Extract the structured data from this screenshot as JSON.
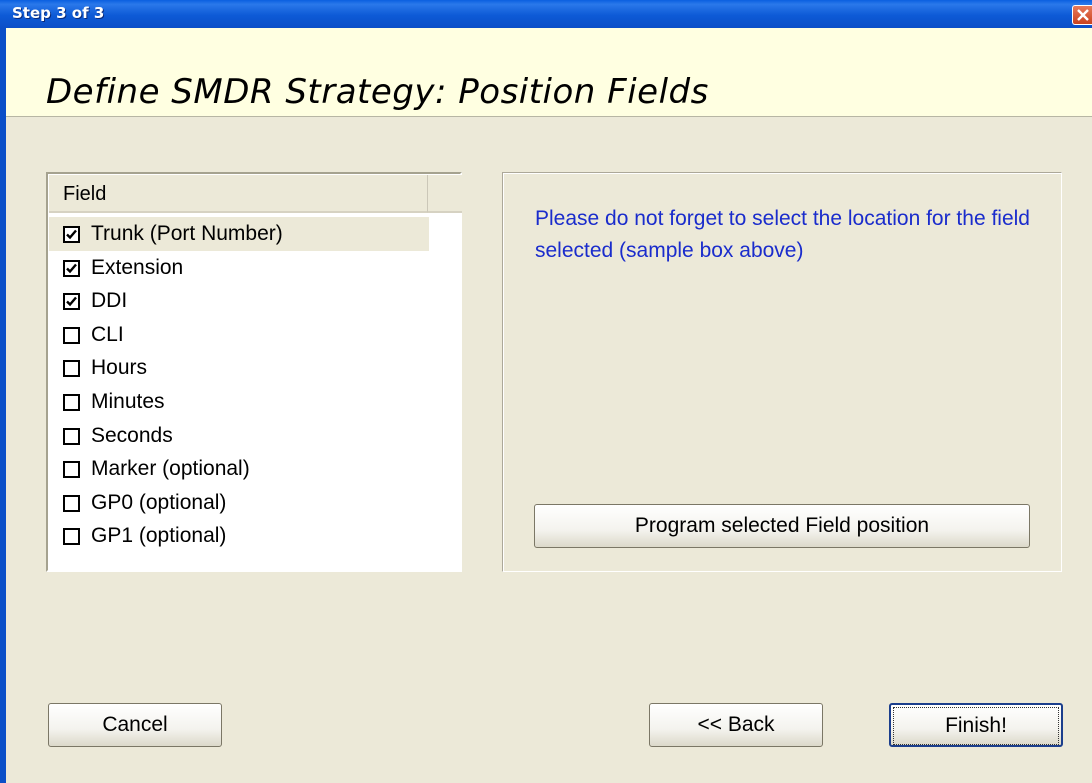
{
  "window": {
    "title": "Step 3 of 3"
  },
  "header": {
    "title": "Define SMDR Strategy: Position Fields"
  },
  "field_list": {
    "column_header": "Field",
    "items": [
      {
        "label": "Trunk (Port Number)",
        "checked": true,
        "selected": true
      },
      {
        "label": "Extension",
        "checked": true,
        "selected": false
      },
      {
        "label": "DDI",
        "checked": true,
        "selected": false
      },
      {
        "label": "CLI",
        "checked": false,
        "selected": false
      },
      {
        "label": "Hours",
        "checked": false,
        "selected": false
      },
      {
        "label": "Minutes",
        "checked": false,
        "selected": false
      },
      {
        "label": "Seconds",
        "checked": false,
        "selected": false
      },
      {
        "label": "Marker (optional)",
        "checked": false,
        "selected": false
      },
      {
        "label": "GP0 (optional)",
        "checked": false,
        "selected": false
      },
      {
        "label": "GP1 (optional)",
        "checked": false,
        "selected": false
      }
    ]
  },
  "info_panel": {
    "message": "Please do not forget to select the location for the field selected (sample box above)",
    "program_button_label": "Program selected Field position"
  },
  "footer": {
    "cancel_label": "Cancel",
    "back_label": "<< Back",
    "finish_label": "Finish!"
  },
  "colors": {
    "titlebar": "#0b4fc8",
    "header_background": "#ffffe1",
    "dialog_background": "#ece9d8",
    "info_text": "#1a2ccc"
  }
}
